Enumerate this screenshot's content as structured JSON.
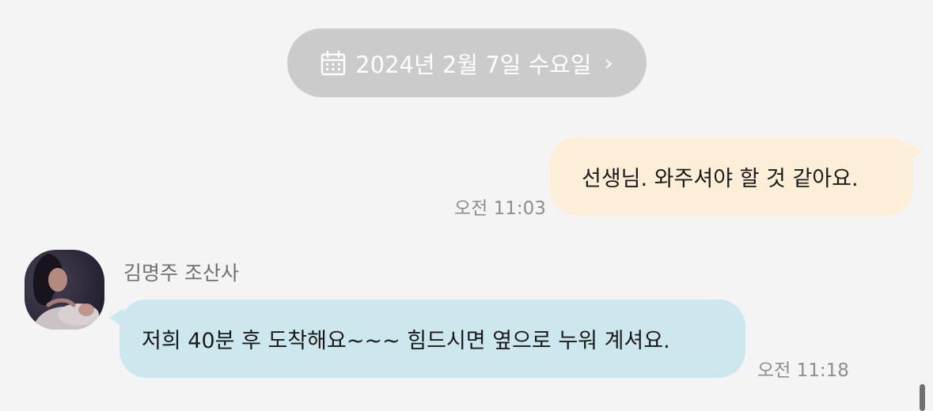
{
  "date_header": {
    "text": "2024년 2월 7일 수요일",
    "icon": "calendar-icon",
    "chevron": "›"
  },
  "messages": [
    {
      "direction": "outgoing",
      "text": "선생님. 와주셔야 할 것 같아요.",
      "time": "오전 11:03"
    },
    {
      "direction": "incoming",
      "sender": "김명주 조산사",
      "avatar": "avatar-photo",
      "text": "저희 40분 후 도착해요~~~ 힘드시면 옆으로 누워 계셔요.",
      "time": "오전 11:18"
    }
  ],
  "colors": {
    "background": "#f4f4f5",
    "date_pill": "#cbcbcc",
    "outgoing_bubble": "#fdefd7",
    "incoming_bubble": "#cde7ef",
    "timestamp": "#8e8e8e"
  }
}
